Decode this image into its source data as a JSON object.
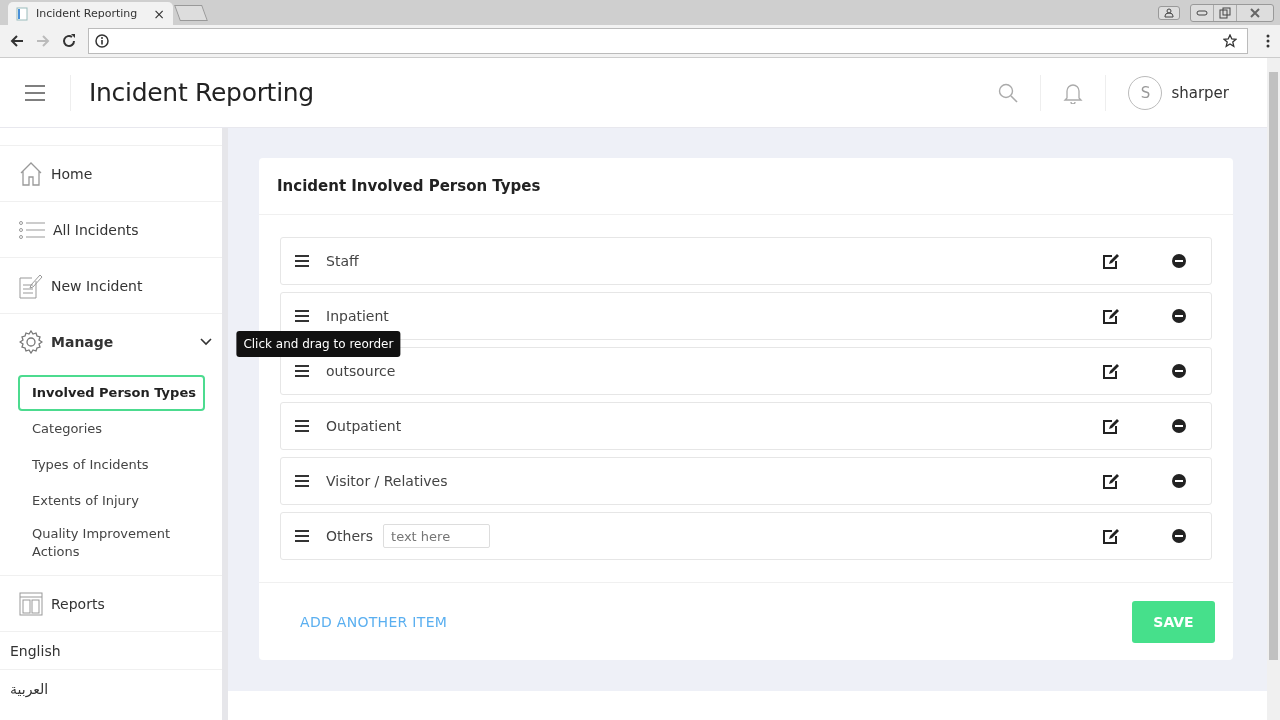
{
  "browser": {
    "tab_title": "Incident Reporting",
    "tab_close": "×"
  },
  "header": {
    "title": "Incident Reporting",
    "user": {
      "initial": "S",
      "name": "sharper"
    }
  },
  "sidebar": {
    "items": [
      {
        "kind": "home",
        "label": "Home"
      },
      {
        "kind": "list",
        "label": "All Incidents"
      },
      {
        "kind": "new",
        "label": "New Incident"
      },
      {
        "kind": "manage",
        "label": "Manage",
        "expanded": true,
        "children": [
          {
            "label": "Involved Person Types",
            "selected": true
          },
          {
            "label": "Categories",
            "selected": false
          },
          {
            "label": "Types of Incidents",
            "selected": false
          },
          {
            "label": "Extents of Injury",
            "selected": false
          },
          {
            "label": "Quality Improvement Actions",
            "selected": false
          }
        ]
      },
      {
        "kind": "reports",
        "label": "Reports"
      }
    ],
    "languages": [
      "English",
      "العربية"
    ]
  },
  "card": {
    "title": "Incident Involved Person Types",
    "items": [
      {
        "kind": "text",
        "label": "Staff"
      },
      {
        "kind": "text",
        "label": "Inpatient"
      },
      {
        "kind": "text",
        "label": "outsource",
        "tooltip": "Click and drag to reorder"
      },
      {
        "kind": "text",
        "label": "Outpatient"
      },
      {
        "kind": "text",
        "label": "Visitor / Relatives"
      },
      {
        "kind": "input",
        "label": "Others",
        "placeholder": "text here"
      }
    ],
    "add_link": "ADD ANOTHER ITEM",
    "save": "SAVE"
  }
}
